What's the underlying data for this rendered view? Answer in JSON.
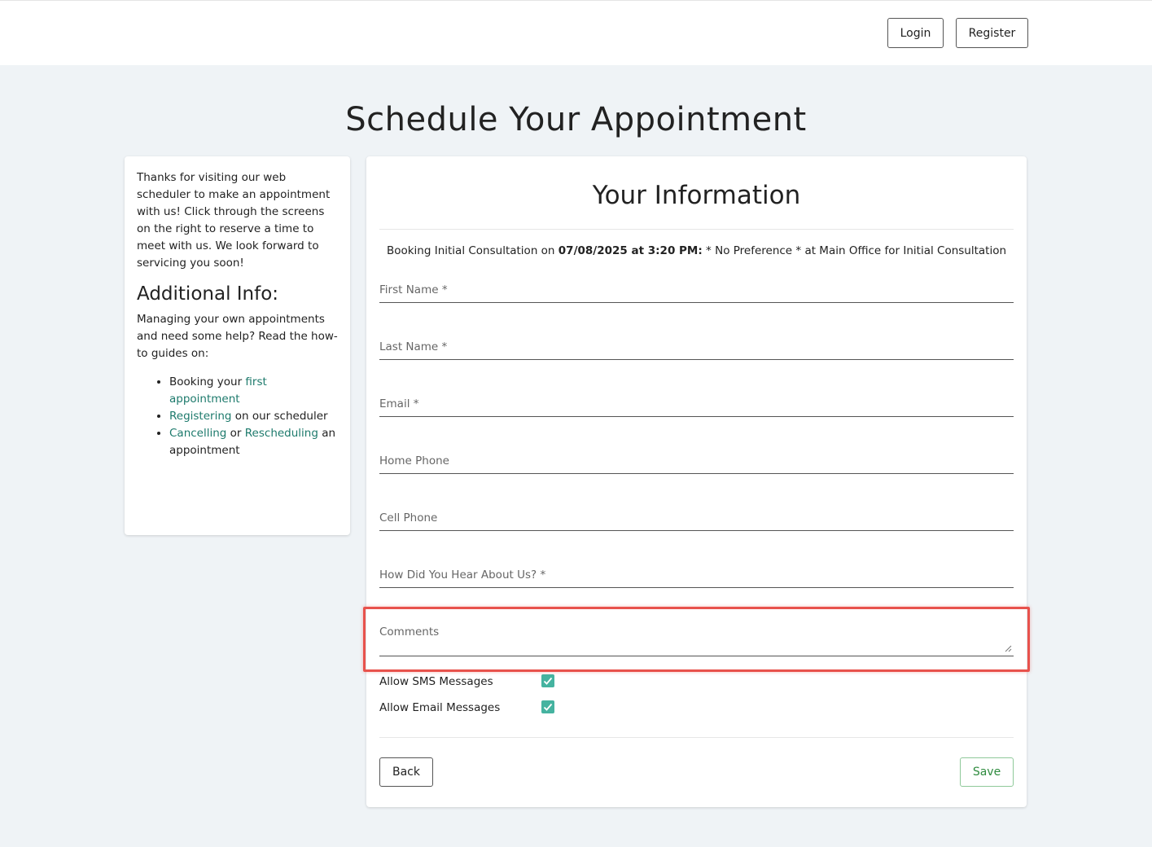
{
  "header": {
    "login_label": "Login",
    "register_label": "Register"
  },
  "page": {
    "title": "Schedule Your Appointment"
  },
  "sidebar": {
    "intro": "Thanks for visiting our web scheduler to make an appointment with us! Click through the screens on the right to reserve a time to meet with us. We look forward to servicing you soon!",
    "heading": "Additional Info:",
    "help_text": "Managing your own appointments and need some help? Read the how-to guides on:",
    "guide_1_prefix": "Booking your ",
    "guide_1_link": "first appointment",
    "guide_2_link": "Registering",
    "guide_2_suffix": " on our scheduler",
    "guide_3_link_a": "Cancelling",
    "guide_3_mid": " or ",
    "guide_3_link_b": "Rescheduling",
    "guide_3_suffix": " an appointment"
  },
  "form": {
    "title": "Your Information",
    "booking_prefix": "Booking Initial Consultation on ",
    "booking_datetime": "07/08/2025 at 3:20 PM:",
    "booking_suffix": " * No Preference * at Main Office for Initial Consultation",
    "first_name_label": "First Name *",
    "last_name_label": "Last Name *",
    "email_label": "Email *",
    "home_phone_label": "Home Phone",
    "cell_phone_label": "Cell Phone",
    "hear_about_label": "How Did You Hear About Us? *",
    "comments_label": "Comments",
    "sms_label": "Allow SMS Messages",
    "sms_checked": true,
    "email_msg_label": "Allow Email Messages",
    "email_msg_checked": true,
    "back_label": "Back",
    "save_label": "Save"
  },
  "colors": {
    "accent_teal": "#45b3a0",
    "link": "#1d7a6c",
    "save_green": "#2e8b3e",
    "highlight_red": "#e8524c"
  }
}
